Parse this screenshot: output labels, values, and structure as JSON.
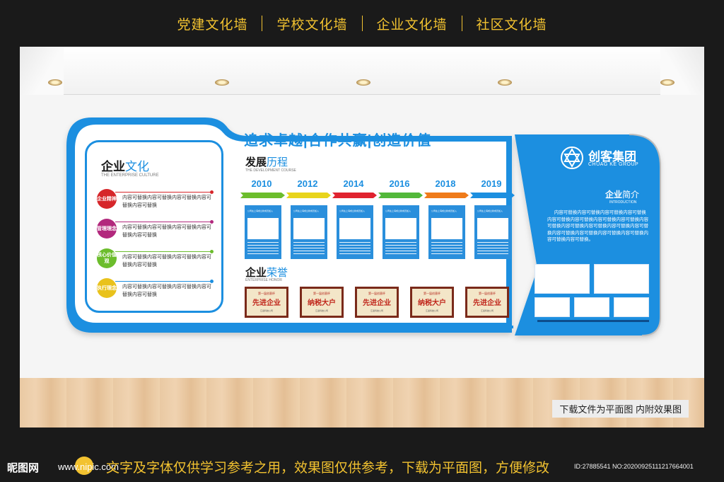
{
  "nav": {
    "items": [
      "党建文化墙",
      "学校文化墙",
      "企业文化墙",
      "社区文化墙"
    ]
  },
  "board": {
    "slogan": "追求卓越|合作共赢|创造价值",
    "culture": {
      "title_a": "企业",
      "title_b": "文化",
      "subtitle": "THE ENTERPRISE CULTURE",
      "values": [
        {
          "label": "企业精神",
          "color": "#d6262a",
          "text": "内容可替换内容可替换内容可替换内容可替换内容可替换"
        },
        {
          "label": "管理理念",
          "color": "#b2287d",
          "text": "内容可替换内容可替换内容可替换内容可替换内容可替换"
        },
        {
          "label": "核心价值观",
          "color": "#6cbd2c",
          "text": "内容可替换内容可替换内容可替换内容可替换内容可替换"
        },
        {
          "label": "执行理念",
          "color": "#1c8fe0",
          "text": "内容可替换内容可替换内容可替换内容可替换内容可替换"
        }
      ]
    },
    "development": {
      "title_a": "发展",
      "title_b": "历程",
      "subtitle": "THE DEVELOPMENT COURSE",
      "years": [
        "2010",
        "2012",
        "2014",
        "2016",
        "2018",
        "2019"
      ],
      "segment_colors": [
        "#6cbd2c",
        "#e8d41c",
        "#e0232f",
        "#52b83a",
        "#ef7b1a",
        "#1c8fe0"
      ],
      "card_text": "公司在上海成立新成员加入"
    },
    "honor": {
      "title_a": "企业",
      "title_b": "荣誉",
      "subtitle": "ENTERPRISE HONOR",
      "plaques": [
        {
          "top": "第一届创意杯",
          "main": "先进企业",
          "bottom": "汇嘉科技公司"
        },
        {
          "top": "第一届创意杯",
          "main": "纳税大户",
          "bottom": "汇嘉科技公司"
        },
        {
          "top": "第一届创意杯",
          "main": "先进企业",
          "bottom": "汇嘉科技公司"
        },
        {
          "top": "第一届创意杯",
          "main": "纳税大户",
          "bottom": "汇嘉科技公司"
        },
        {
          "top": "第一届创意杯",
          "main": "先进企业",
          "bottom": "汇嘉科技公司"
        }
      ]
    },
    "company": {
      "name": "创客集团",
      "name_en": "CHUAG KE GROUP",
      "intro_title_a": "企业",
      "intro_title_b": "简介",
      "intro_subtitle": "INTRODUCTION",
      "intro_text": "内容可替换内容可替换内容可替换内容可替换内容可替换内容可替换内容可替换内容可替换内容可替换内容可替换内容可替换内容可替换内容可替换内容可替换内容可替换内容可替换内容可替换内容可替换内容可替换。"
    }
  },
  "floor_note": "下载文件为平面图 内附效果图",
  "bottom": {
    "logo": "昵图网",
    "site": "www.nipic.com",
    "notice": "文字及字体仅供学习参考之用，效果图仅供参考，下载为平面图，方便修改",
    "id_text": "ID:27885541 NO:20200925111217664001"
  },
  "colors": {
    "accent": "#1c8fe0",
    "gold": "#f2c230"
  }
}
